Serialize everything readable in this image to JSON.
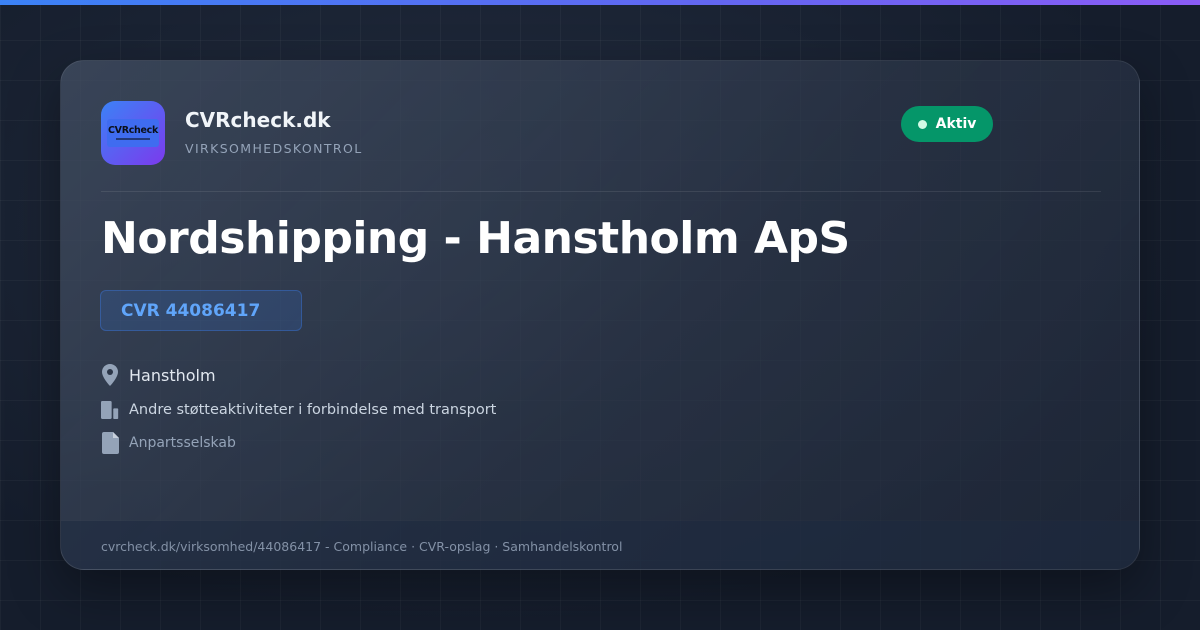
{
  "brand": {
    "logo_text": "CVRcheck",
    "name": "CVRcheck.dk",
    "tagline": "VIRKSOMHEDSKONTROL"
  },
  "status": {
    "label": "Aktiv",
    "color": "#059669"
  },
  "company": {
    "name": "Nordshipping - Hanstholm ApS",
    "cvr": "CVR 44086417",
    "location": "Hanstholm",
    "industry": "Andre støtteaktiviteter i forbindelse med transport",
    "type": "Anpartsselskab"
  },
  "icons": {
    "location": "map-pin-icon",
    "industry": "building-icon",
    "type": "document-icon"
  },
  "footer": {
    "text": "cvrcheck.dk/virksomhed/44086417 - Compliance · CVR-opslag · Samhandelskontrol"
  },
  "colors": {
    "accent": "#3b82f6",
    "accent_secondary": "#7c3aed",
    "cvr_text": "#60a5fa",
    "background": "#151d2c"
  }
}
